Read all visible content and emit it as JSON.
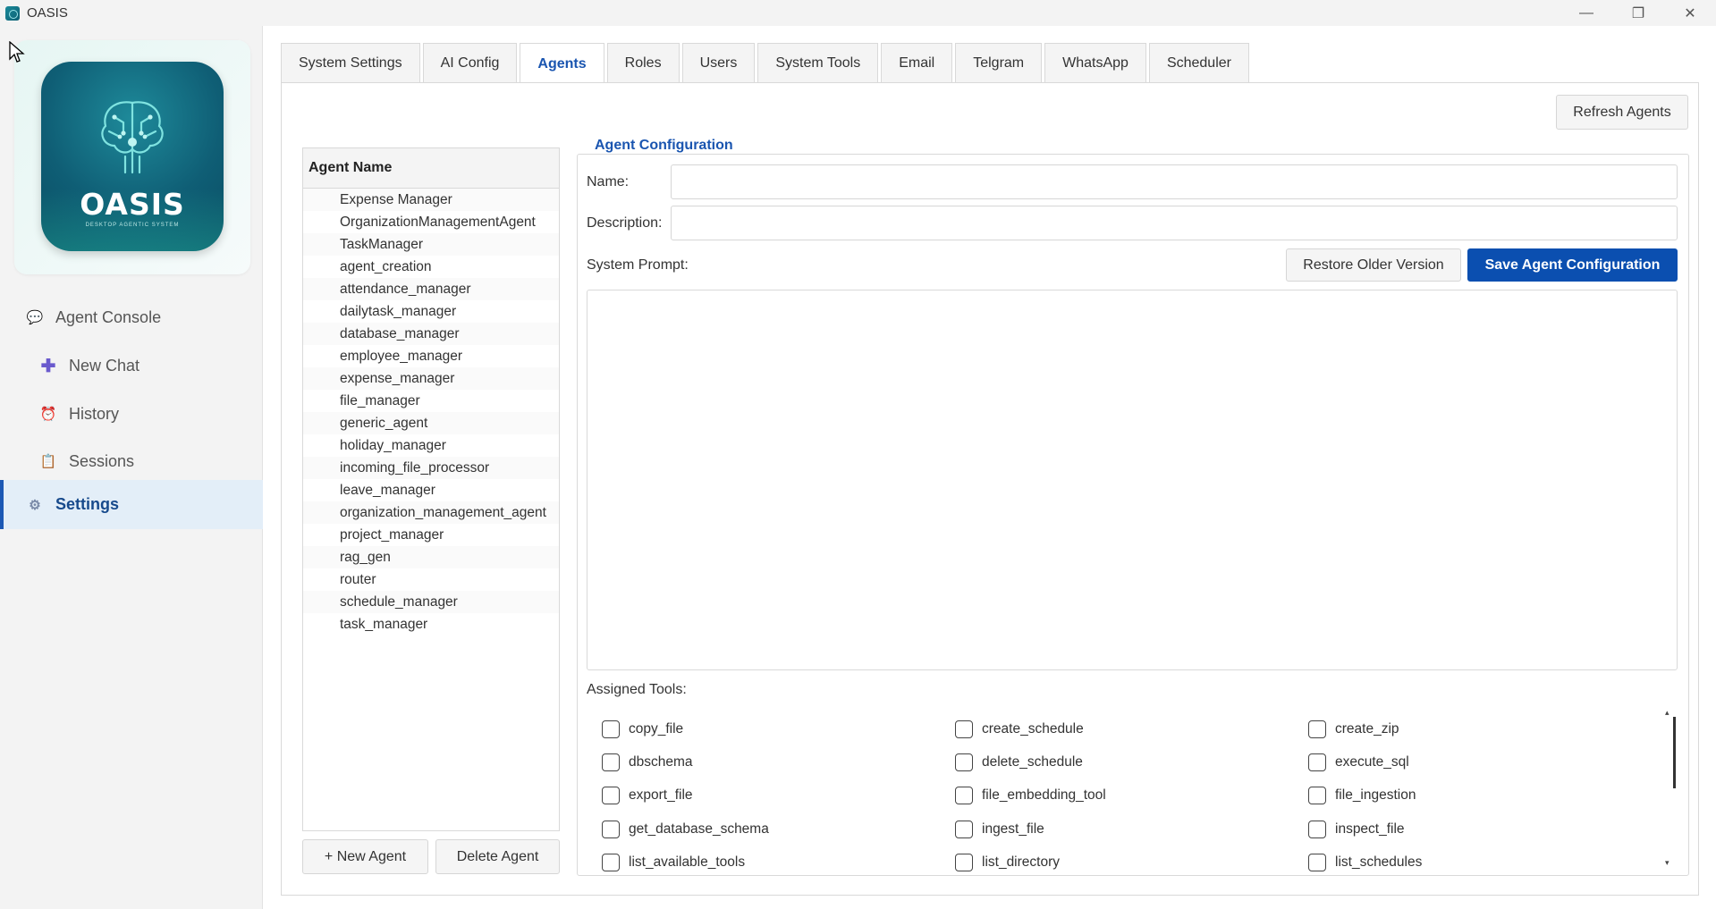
{
  "window": {
    "title": "OASIS",
    "controls": [
      "minimize",
      "maximize",
      "close"
    ]
  },
  "sidebar": {
    "logo": {
      "text": "OASIS",
      "subtitle": "DESKTOP AGENTIC SYSTEM"
    },
    "items": [
      {
        "label": "Agent Console",
        "icon": "chat-bubble-icon"
      },
      {
        "label": "New Chat",
        "icon": "plus-icon"
      },
      {
        "label": "History",
        "icon": "history-icon"
      },
      {
        "label": "Sessions",
        "icon": "sessions-icon"
      },
      {
        "label": "Settings",
        "icon": "gear-icon",
        "active": true
      }
    ]
  },
  "tabs": [
    {
      "label": "System Settings"
    },
    {
      "label": "AI Config"
    },
    {
      "label": "Agents",
      "active": true
    },
    {
      "label": "Roles"
    },
    {
      "label": "Users"
    },
    {
      "label": "System Tools"
    },
    {
      "label": "Email"
    },
    {
      "label": "Telgram"
    },
    {
      "label": "WhatsApp"
    },
    {
      "label": "Scheduler"
    }
  ],
  "agents": {
    "refresh_label": "Refresh Agents",
    "list_header": "Agent Name",
    "list": [
      "Expense Manager",
      "OrganizationManagementAgent",
      "TaskManager",
      "agent_creation",
      "attendance_manager",
      "dailytask_manager",
      "database_manager",
      "employee_manager",
      "expense_manager",
      "file_manager",
      "generic_agent",
      "holiday_manager",
      "incoming_file_processor",
      "leave_manager",
      "organization_management_agent",
      "project_manager",
      "rag_gen",
      "router",
      "schedule_manager",
      "task_manager"
    ],
    "new_agent_label": "+ New Agent",
    "delete_agent_label": "Delete Agent"
  },
  "config": {
    "title": "Agent Configuration",
    "name_label": "Name:",
    "name_value": "",
    "description_label": "Description:",
    "description_value": "",
    "system_prompt_label": "System Prompt:",
    "system_prompt_value": "",
    "restore_label": "Restore Older Version",
    "save_label": "Save Agent Configuration",
    "assigned_tools_label": "Assigned Tools:",
    "tools": [
      {
        "name": "copy_file",
        "checked": false
      },
      {
        "name": "create_schedule",
        "checked": false
      },
      {
        "name": "create_zip",
        "checked": false
      },
      {
        "name": "dbschema",
        "checked": false
      },
      {
        "name": "delete_schedule",
        "checked": false
      },
      {
        "name": "execute_sql",
        "checked": false
      },
      {
        "name": "export_file",
        "checked": false
      },
      {
        "name": "file_embedding_tool",
        "checked": false
      },
      {
        "name": "file_ingestion",
        "checked": false
      },
      {
        "name": "get_database_schema",
        "checked": false
      },
      {
        "name": "ingest_file",
        "checked": false
      },
      {
        "name": "inspect_file",
        "checked": false
      },
      {
        "name": "list_available_tools",
        "checked": false
      },
      {
        "name": "list_directory",
        "checked": false
      },
      {
        "name": "list_schedules",
        "checked": false
      }
    ]
  },
  "colors": {
    "accent": "#1a55b0",
    "primary_button": "#0b4fb0",
    "active_nav_bg": "#e3eef8"
  }
}
